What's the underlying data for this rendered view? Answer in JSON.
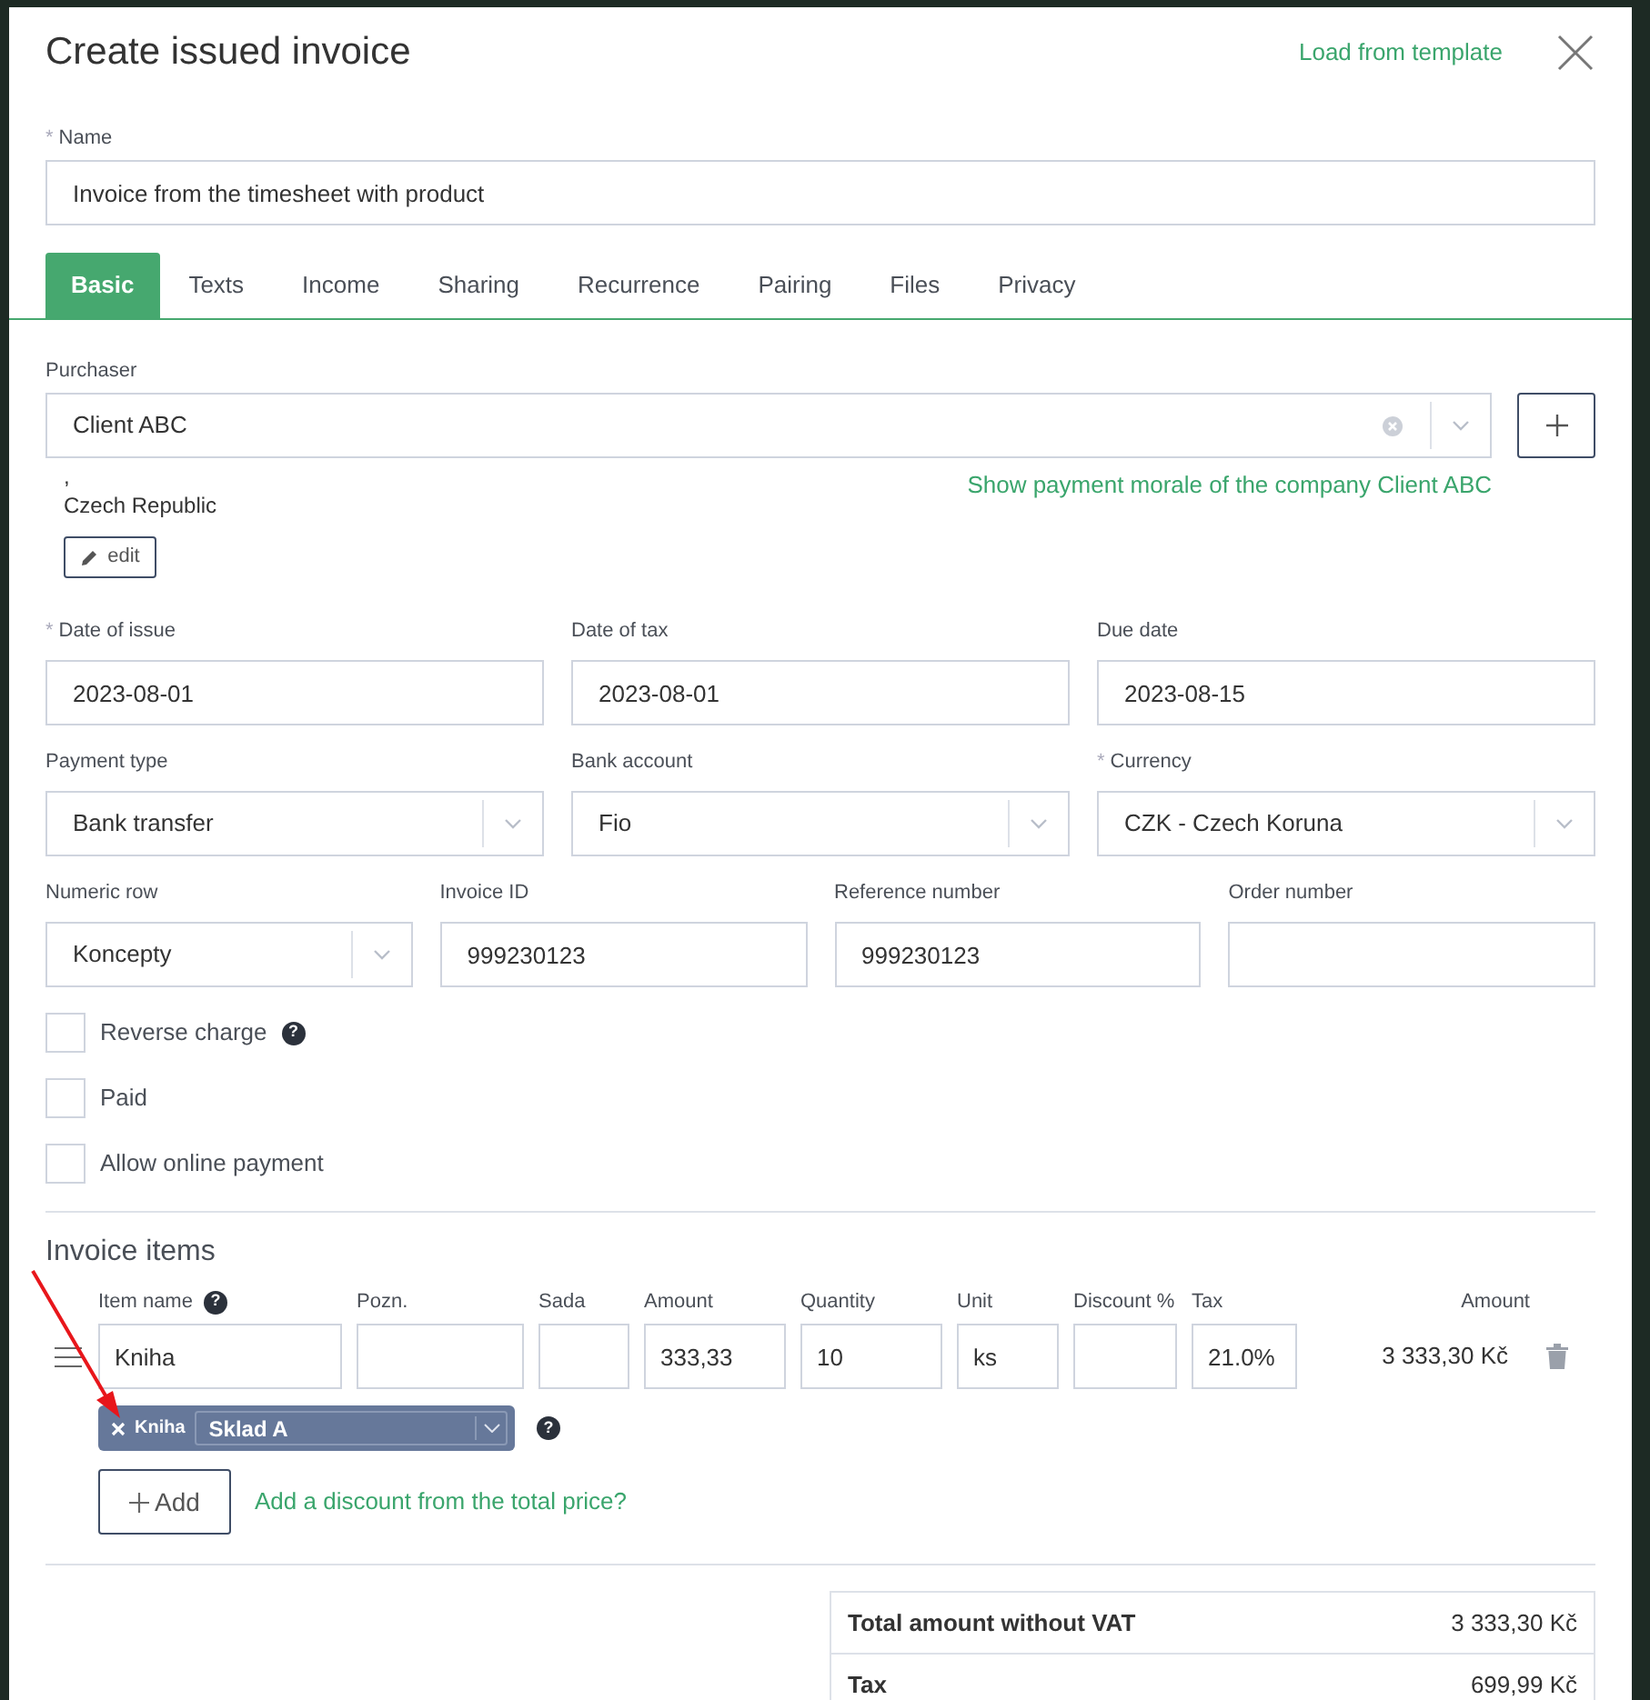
{
  "dialog": {
    "title": "Create issued invoice",
    "template_link": "Load from template"
  },
  "name_field": {
    "label": "Name",
    "required_mark": "*",
    "value": "Invoice from the timesheet with product"
  },
  "tabs": [
    {
      "label": "Basic",
      "selected": true
    },
    {
      "label": "Texts",
      "selected": false
    },
    {
      "label": "Income",
      "selected": false
    },
    {
      "label": "Sharing",
      "selected": false
    },
    {
      "label": "Recurrence",
      "selected": false
    },
    {
      "label": "Pairing",
      "selected": false
    },
    {
      "label": "Files",
      "selected": false
    },
    {
      "label": "Privacy",
      "selected": false
    }
  ],
  "purchaser": {
    "label": "Purchaser",
    "value": "Client ABC",
    "address_line": ",",
    "country": "Czech Republic",
    "edit_button": "edit",
    "morale_link": "Show payment morale of the company Client ABC"
  },
  "field_rows": [
    [
      {
        "label": "Date of issue",
        "required_mark": "*",
        "kind": "text",
        "value": "2023-08-01"
      },
      {
        "label": "Date of tax",
        "kind": "text",
        "value": "2023-08-01"
      },
      {
        "label": "Due date",
        "kind": "text",
        "value": "2023-08-15"
      }
    ],
    [
      {
        "label": "Payment type",
        "kind": "select",
        "value": "Bank transfer"
      },
      {
        "label": "Bank account",
        "kind": "select",
        "value": "Fio"
      },
      {
        "label": "Currency",
        "required_mark": "*",
        "kind": "select",
        "value": "CZK - Czech Koruna"
      }
    ],
    [
      {
        "label": "Numeric row",
        "kind": "select",
        "value": "Koncepty"
      },
      {
        "label": "Invoice ID",
        "kind": "text",
        "value": "999230123"
      },
      {
        "label": "Reference number",
        "kind": "text",
        "value": "999230123"
      },
      {
        "label": "Order number",
        "kind": "text"
      }
    ]
  ],
  "checkboxes": [
    {
      "label": "Reverse charge",
      "checked": false,
      "help": "?"
    },
    {
      "label": "Paid",
      "checked": false
    },
    {
      "label": "Allow online payment",
      "checked": false
    }
  ],
  "items": {
    "title": "Invoice items",
    "columns": [
      {
        "label": "Item name",
        "help": "?"
      },
      {
        "label": "Pozn."
      },
      {
        "label": "Sada"
      },
      {
        "label": "Amount"
      },
      {
        "label": "Quantity"
      },
      {
        "label": "Unit"
      },
      {
        "label": "Discount %"
      },
      {
        "label": "Tax"
      },
      {
        "label": "Amount"
      }
    ],
    "rows": [
      {
        "cells": [
          "Kniha",
          "",
          "",
          "333,33",
          "10",
          "ks",
          "",
          "21.0%"
        ],
        "total": "3 333,30 Kč",
        "stock_tag": {
          "product": "Kniha",
          "warehouse": "Sklad A",
          "help": "?"
        }
      }
    ],
    "add_button": "Add",
    "discount_link": "Add a discount from the total price?"
  },
  "totals": [
    {
      "label": "Total amount without VAT",
      "value": "3 333,30 Kč"
    },
    {
      "label": "Tax",
      "value": "699,99 Kč"
    }
  ]
}
